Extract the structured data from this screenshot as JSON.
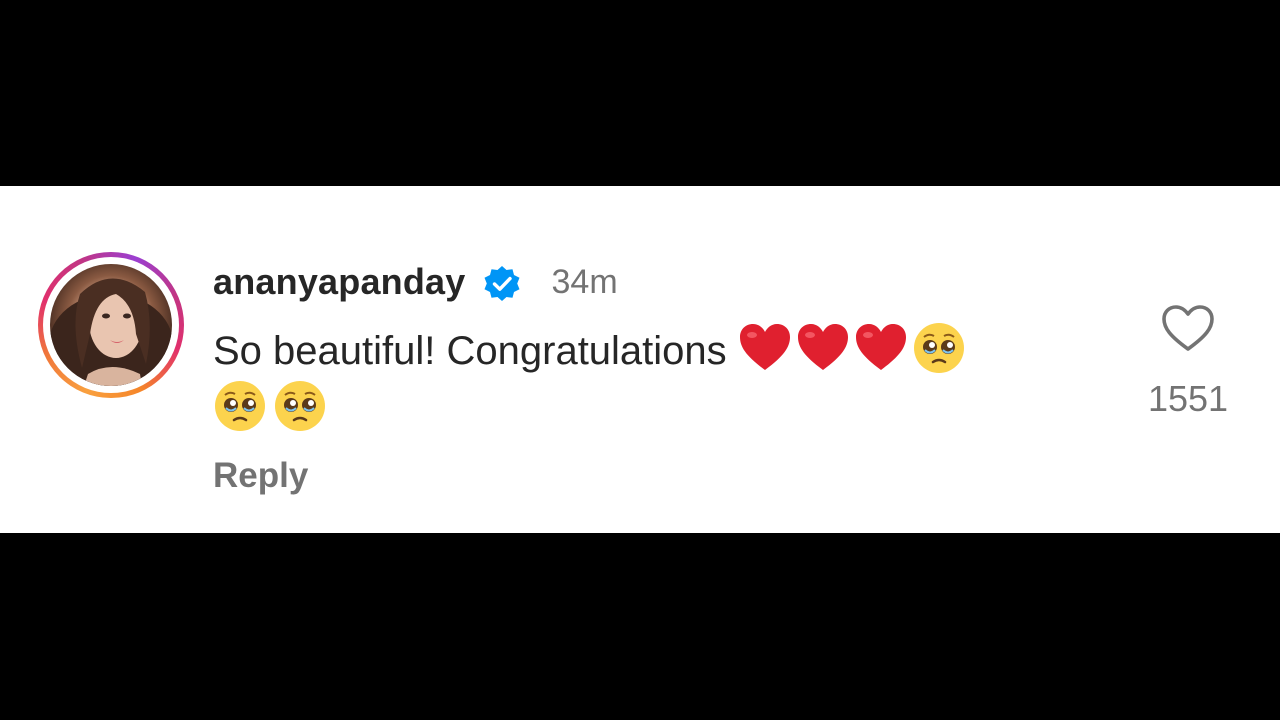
{
  "comment": {
    "username": "ananyapanday",
    "verified": true,
    "timestamp": "34m",
    "text": "So beautiful! Congratulations",
    "emojis_line1": [
      "red-heart",
      "red-heart",
      "red-heart",
      "pleading-face"
    ],
    "emojis_line2": [
      "pleading-face",
      "pleading-face"
    ],
    "reply_label": "Reply",
    "like_count": "1551"
  },
  "icons": {
    "verified": "verified-badge-icon",
    "like": "heart-outline-icon"
  },
  "colors": {
    "verified_blue": "#0095f6",
    "heart_red": "#e0202f",
    "secondary_text": "#737373",
    "primary_text": "#262626"
  }
}
